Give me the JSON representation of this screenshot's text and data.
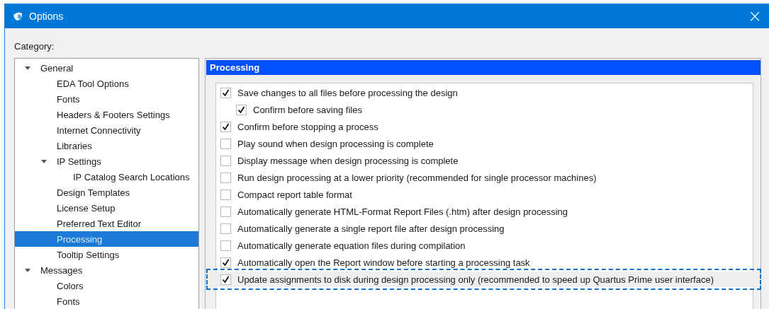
{
  "window": {
    "title": "Options",
    "close": "×"
  },
  "category_label": "Category:",
  "tree": [
    {
      "label": "General",
      "expanded": true,
      "selected": false,
      "children": [
        {
          "label": "EDA Tool Options",
          "selected": false
        },
        {
          "label": "Fonts",
          "selected": false
        },
        {
          "label": "Headers & Footers Settings",
          "selected": false
        },
        {
          "label": "Internet Connectivity",
          "selected": false
        },
        {
          "label": "Libraries",
          "selected": false
        },
        {
          "label": "IP Settings",
          "expanded": true,
          "selected": false,
          "children": [
            {
              "label": "IP Catalog Search Locations",
              "selected": false
            }
          ]
        },
        {
          "label": "Design Templates",
          "selected": false
        },
        {
          "label": "License Setup",
          "selected": false
        },
        {
          "label": "Preferred Text Editor",
          "selected": false
        },
        {
          "label": "Processing",
          "selected": true
        },
        {
          "label": "Tooltip Settings",
          "selected": false
        }
      ]
    },
    {
      "label": "Messages",
      "expanded": true,
      "selected": false,
      "children": [
        {
          "label": "Colors",
          "selected": false
        },
        {
          "label": "Fonts",
          "selected": false
        }
      ]
    }
  ],
  "panel": {
    "title": "Processing",
    "options": [
      {
        "label": "Save changes to all files before processing the design",
        "checked": true,
        "highlighted": false,
        "children": [
          {
            "label": "Confirm before saving files",
            "checked": true,
            "highlighted": false
          }
        ]
      },
      {
        "label": "Confirm before stopping a process",
        "checked": true,
        "highlighted": false
      },
      {
        "label": "Play sound when design processing is complete",
        "checked": false,
        "highlighted": false
      },
      {
        "label": "Display message when design processing is complete",
        "checked": false,
        "highlighted": false
      },
      {
        "label": "Run design processing at a lower priority (recommended for single processor machines)",
        "checked": false,
        "highlighted": false
      },
      {
        "label": "Compact report table format",
        "checked": false,
        "highlighted": false
      },
      {
        "label": "Automatically generate HTML-Format Report Files (.htm) after design processing",
        "checked": false,
        "highlighted": false
      },
      {
        "label": "Automatically generate a single report file after design processing",
        "checked": false,
        "highlighted": false
      },
      {
        "label": "Automatically generate equation files during compilation",
        "checked": false,
        "highlighted": false
      },
      {
        "label": "Automatically open the Report window before starting a processing task",
        "checked": true,
        "highlighted": false
      },
      {
        "label": "Update assignments to disk during design processing only (recommended to speed up Quartus Prime user interface)",
        "checked": true,
        "highlighted": true
      }
    ]
  }
}
